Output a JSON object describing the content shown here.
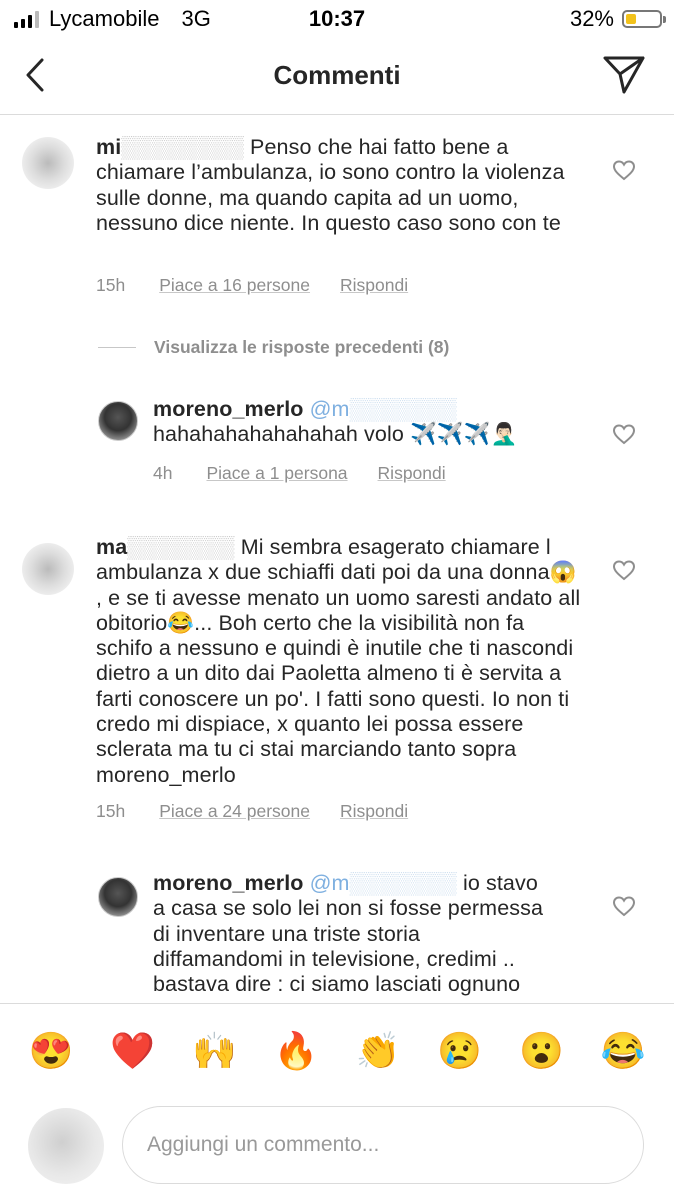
{
  "status": {
    "carrier": "Lycamobile",
    "network": "3G",
    "time": "10:37",
    "battery": "32%",
    "battery_level": 0.32,
    "signal_bars": 3
  },
  "header": {
    "title": "Commenti"
  },
  "comments": [
    {
      "username": "mi",
      "text": "Penso che hai fatto bene a chiamare l’ambulanza, io sono contro la violenza sulle donne, ma quando capita ad un uomo, nessuno dice niente. In questo caso sono con te",
      "time": "15h",
      "likes": "Piace a 16 persone",
      "reply": "Rispondi"
    },
    {
      "view_replies": "Visualizza le risposte precedenti (8)"
    },
    {
      "username": "moreno_merlo",
      "mention": "@m",
      "text": "hahahahahahahahah volo ✈️✈️✈️🤦🏻‍♂️",
      "time": "4h",
      "likes": "Piace a 1 persona",
      "reply": "Rispondi"
    },
    {
      "username": "ma",
      "text": "Mi sembra esagerato chiamare l ambulanza x due schiaffi dati poi da una donna😱 , e se ti avesse menato un uomo saresti andato all obitorio😂... Boh certo che la visibilità non fa schifo a nessuno e quindi è inutile che ti nascondi dietro a un dito dai Paoletta almeno ti è servita a farti conoscere un po'. I fatti sono questi. Io non ti credo mi dispiace, x quanto lei possa essere sclerata ma tu ci stai marciando tanto sopra moreno_merlo",
      "time": "15h",
      "likes": "Piace a 24 persone",
      "reply": "Rispondi"
    },
    {
      "username": "moreno_merlo",
      "mention": "@m",
      "text": "io stavo a casa se solo lei non si fosse permessa di inventare una triste storia diffamandomi in televisione, credimi .. bastava dire : ci siamo lasciati ognuno"
    }
  ],
  "emojis": [
    "😍",
    "❤️",
    "🙌",
    "🔥",
    "👏",
    "😢",
    "😮",
    "😂"
  ],
  "composer": {
    "placeholder": "Aggiungi un commento..."
  }
}
